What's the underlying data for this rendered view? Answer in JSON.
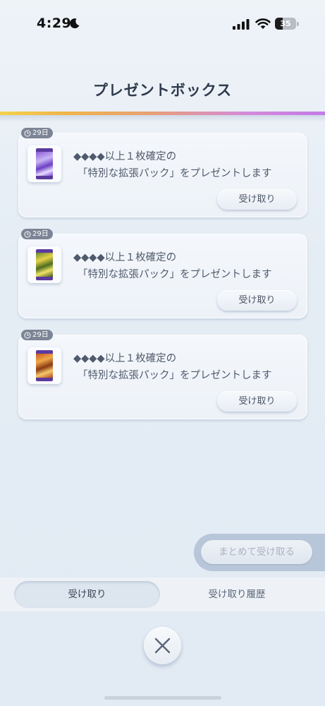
{
  "status_bar": {
    "time": "4:29",
    "battery_percent": 35,
    "battery_label": "35"
  },
  "header": {
    "title": "プレゼントボックス"
  },
  "presents": [
    {
      "days_left": "29日",
      "line1": "◆◆◆◆以上１枚確定の",
      "line2": "「特別な拡張パック」をプレゼントします",
      "receive_label": "受け取り",
      "pack_theme": "purple"
    },
    {
      "days_left": "29日",
      "line1": "◆◆◆◆以上１枚確定の",
      "line2": "「特別な拡張パック」をプレゼントします",
      "receive_label": "受け取り",
      "pack_theme": "yellow"
    },
    {
      "days_left": "29日",
      "line1": "◆◆◆◆以上１枚確定の",
      "line2": "「特別な拡張パック」をプレゼントします",
      "receive_label": "受け取り",
      "pack_theme": "orange"
    }
  ],
  "bulk_receive_label": "まとめて受け取る",
  "tabs": {
    "receive": "受け取り",
    "history": "受け取り履歴"
  },
  "icons": {
    "clock": "clock-icon",
    "close": "close-icon",
    "moon": "moon-icon",
    "signal": "signal-icon",
    "wifi": "wifi-icon",
    "battery": "battery-icon"
  },
  "colors": {
    "badge": "#7c8595",
    "accent_gradient_start": "#f3d24c",
    "accent_gradient_end": "#c37be8",
    "bulk_disabled_text": "#aab3c1"
  }
}
